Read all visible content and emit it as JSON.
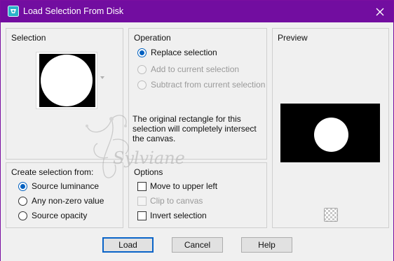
{
  "window": {
    "title": "Load Selection From Disk"
  },
  "selection_group": {
    "title": "Selection"
  },
  "operation": {
    "title": "Operation",
    "options": [
      {
        "label": "Replace selection",
        "checked": true,
        "enabled": true
      },
      {
        "label": "Add to current selection",
        "checked": false,
        "enabled": false
      },
      {
        "label": "Subtract from current selection",
        "checked": false,
        "enabled": false
      }
    ],
    "info_text": "The original rectangle for this selection will completely intersect the canvas."
  },
  "preview": {
    "title": "Preview"
  },
  "create_from": {
    "title": "Create selection from:",
    "options": [
      {
        "label": "Source luminance",
        "checked": true
      },
      {
        "label": "Any non-zero value",
        "checked": false
      },
      {
        "label": "Source opacity",
        "checked": false
      }
    ]
  },
  "options_group": {
    "title": "Options",
    "items": [
      {
        "label": "Move to upper left",
        "checked": false,
        "enabled": true
      },
      {
        "label": "Clip to canvas",
        "checked": false,
        "enabled": false
      },
      {
        "label": "Invert selection",
        "checked": false,
        "enabled": true
      }
    ]
  },
  "buttons": {
    "load": "Load",
    "cancel": "Cancel",
    "help": "Help"
  },
  "watermark": "Sylviane",
  "colors": {
    "titlebar": "#720da0",
    "accent": "#0060c0",
    "dialog_bg": "#f0f0f0"
  }
}
